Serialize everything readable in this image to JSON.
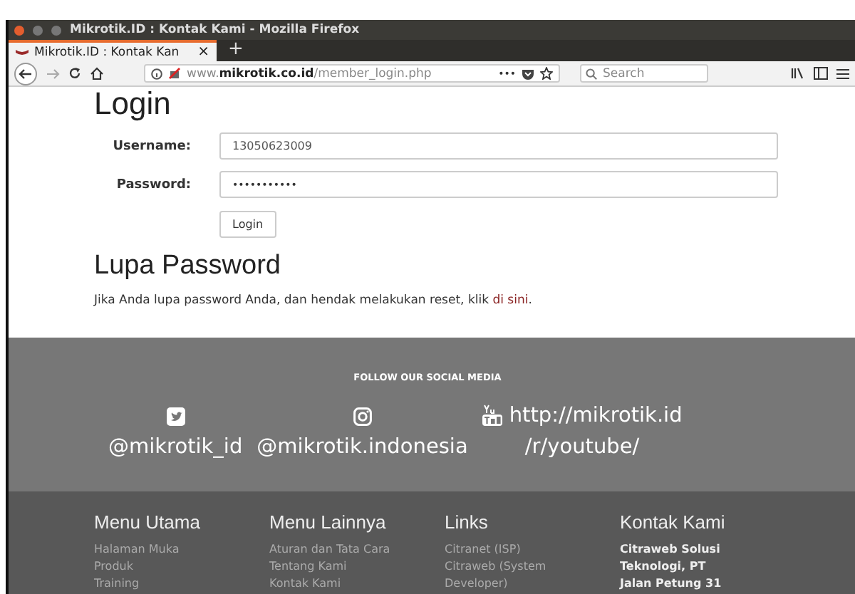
{
  "window": {
    "title": "Mikrotik.ID : Kontak Kami - Mozilla Firefox"
  },
  "tabs": [
    {
      "label": "Mikrotik.ID : Kontak Kan",
      "close": "×",
      "selected": true
    }
  ],
  "new_tab": "+",
  "address_bar": {
    "url": "www.**mikrotik.co.id**/member_login.php",
    "more": "•••"
  },
  "search": {
    "placeholder": "Search"
  },
  "login": {
    "heading": "Login",
    "fields": [
      {
        "label": "Username:",
        "kind": "text",
        "value": "13050623009"
      },
      {
        "label": "Password:",
        "kind": "password",
        "value": "•••••••••••"
      }
    ],
    "button": "Login"
  },
  "forgot": {
    "heading": "Lupa Password",
    "text": "Jika Anda lupa password Anda, dan hendak melakukan reset, klik ",
    "link": "di sini",
    "after": "."
  },
  "social": {
    "title": "FOLLOW OUR SOCIAL MEDIA",
    "items": [
      {
        "kind": "twitter",
        "handle": "@mikrotik_id"
      },
      {
        "kind": "instagram",
        "handle": "@mikrotik.indonesia"
      },
      {
        "kind": "youtube",
        "url": "http://mikrotik.id",
        "handle": "/r/youtube/"
      }
    ]
  },
  "footer": {
    "columns": [
      {
        "heading": "Menu Utama",
        "kind": "links",
        "items": [
          "Halaman Muka",
          "Produk",
          "Training"
        ]
      },
      {
        "heading": "Menu Lainnya",
        "kind": "links",
        "items": [
          "Aturan dan Tata Cara",
          "Tentang Kami",
          "Kontak Kami"
        ]
      },
      {
        "heading": "Links",
        "kind": "links",
        "items": [
          "Citranet (ISP)",
          "Citraweb (System Developer)"
        ]
      },
      {
        "heading": "Kontak Kami",
        "kind": "contact",
        "items": [
          "Citraweb Solusi Teknologi, PT",
          "Jalan Petung 31"
        ]
      }
    ]
  }
}
